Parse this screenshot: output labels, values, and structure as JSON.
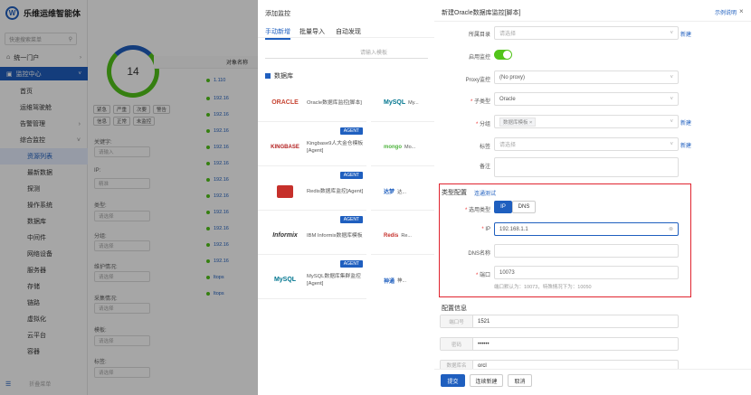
{
  "app": {
    "title": "乐维运维智能体"
  },
  "sidebar": {
    "search_placeholder": "快速搜索菜单",
    "groups": [
      {
        "label": "统一门户",
        "icon": "home-icon"
      },
      {
        "label": "监控中心",
        "icon": "monitor-icon"
      }
    ],
    "items": [
      "首页",
      "运维驾驶舱",
      "告警管理",
      "综合监控",
      "资源列表",
      "最新数据",
      "探测",
      "操作系统",
      "数据库",
      "中间件",
      "网络设备",
      "服务器",
      "存储",
      "链路",
      "虚拟化",
      "云平台",
      "容器"
    ],
    "footer_label": "折叠菜单"
  },
  "list": {
    "total": "14",
    "status_chips": [
      "紧急",
      "严重",
      "次要",
      "警告",
      "信息",
      "正常",
      "未监控"
    ],
    "filters": [
      {
        "label": "关键字:",
        "placeholder": "请输入"
      },
      {
        "label": "IP:",
        "placeholder": "精准"
      },
      {
        "label": "类型:",
        "placeholder": "请选择"
      },
      {
        "label": "分组:",
        "placeholder": "请选择"
      },
      {
        "label": "维护情况:",
        "placeholder": "请选择"
      },
      {
        "label": "采集情况:",
        "placeholder": "请选择"
      },
      {
        "label": "模板:",
        "placeholder": "请选择"
      },
      {
        "label": "标签:",
        "placeholder": "请选择"
      }
    ],
    "column_header": "对象名称",
    "rows": [
      "1.110",
      "192.16",
      "192.16",
      "192.16",
      "192.16",
      "192.16",
      "192.16",
      "192.16",
      "192.16",
      "192.16",
      "192.16",
      "192.16",
      "ltops",
      "ltops"
    ]
  },
  "add_dialog": {
    "title": "添加监控",
    "tabs": [
      "手动新增",
      "批量导入",
      "自动发现"
    ],
    "search_placeholder": "请输入模板",
    "section": "数据库",
    "cards_left": [
      {
        "logo": "ORACLE",
        "text": "Oracle数据库监控[脚本]",
        "agent": ""
      },
      {
        "logo": "KINGBASE",
        "text": "Kingbase9人大金仓模板[Agent]",
        "agent": "AGENT"
      },
      {
        "logo": "redis",
        "text": "Redis数据库监控[Agent]",
        "agent": "AGENT"
      },
      {
        "logo": "Informix",
        "text": "IBM Informix数据库模板",
        "agent": "AGENT"
      },
      {
        "logo": "MySQL",
        "text": "MySQL数据库集群监控[Agent]",
        "agent": "AGENT"
      }
    ],
    "cards_right": [
      {
        "logo": "MySQL",
        "text": "My..."
      },
      {
        "logo": "mongo",
        "text": "Mo..."
      },
      {
        "logo": "达梦",
        "text": "达..."
      },
      {
        "logo": "Redis",
        "text": "Re..."
      },
      {
        "logo": "神通",
        "text": "神..."
      }
    ]
  },
  "form": {
    "title": "新建Oracle数据库监控[脚本]",
    "help_link": "示例说明",
    "new_link": "新建",
    "fields": {
      "group_dir": {
        "label": "所属目录",
        "placeholder": "请选择"
      },
      "enable": {
        "label": "启用监控"
      },
      "proxy": {
        "label": "Proxy监控",
        "value": "(No proxy)"
      },
      "subtype": {
        "label": "子类型",
        "value": "Oracle"
      },
      "group": {
        "label": "分组",
        "tag": "数据库模板"
      },
      "tags": {
        "label": "标签",
        "placeholder": "请选择"
      },
      "note": {
        "label": "备注"
      }
    },
    "type_config": {
      "title": "类型配置",
      "test_link": "连通测试",
      "select_label": "选用类型",
      "options": [
        "IP",
        "DNS"
      ],
      "ip_label": "IP",
      "ip_value": "192.168.1.1",
      "dns_label": "DNS名称",
      "port_label": "端口",
      "port_value": "10073",
      "port_hint": "端口默认为：10073，特殊情况下为：10050"
    },
    "config_info": {
      "title": "配置信息",
      "rows": [
        {
          "label": "端口号",
          "value": "1521"
        },
        {
          "label": "密码",
          "value": "••••••"
        },
        {
          "label": "数据库名",
          "value": "orcl"
        }
      ]
    },
    "buttons": {
      "submit": "提交",
      "continue": "连续新建",
      "cancel": "取消"
    }
  },
  "colors": {
    "primary": "#1f5fbf",
    "highlight_border": "#e0242f",
    "toggle_on": "#52c41a"
  }
}
